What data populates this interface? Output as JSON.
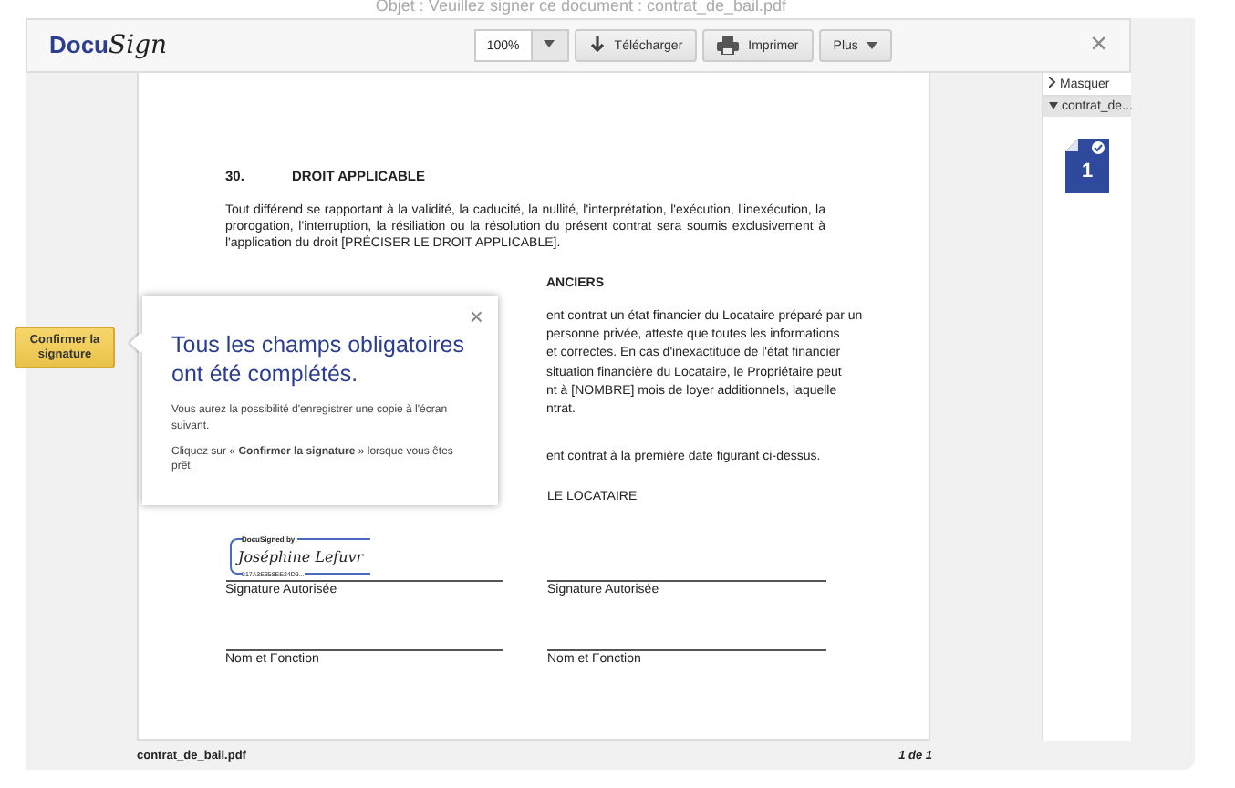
{
  "window": {
    "title": "Objet : Veuillez signer ce document : contrat_de_bail.pdf"
  },
  "toolbar": {
    "logo": {
      "main": "Docu",
      "script": "Sign"
    },
    "zoom": "100%",
    "buttons": [
      {
        "kind": "download",
        "label": "Télécharger"
      },
      {
        "kind": "print",
        "label": "Imprimer"
      },
      {
        "kind": "more",
        "label": "Plus"
      }
    ],
    "close": "×"
  },
  "confirm_button": "Confirmer la signature",
  "popup": {
    "title": "Tous les champs obligatoires ont été complétés.",
    "text_1": "Vous aurez la possibilité d'enregistrer une copie à l'écran suivant.",
    "text_2": "Cliquez sur « **Confirmer la signature** » lorsque vous êtes prêt.",
    "close": "×"
  },
  "document": {
    "section_number": "30.",
    "section_title": "DROIT APPLICABLE",
    "section_text": "Tout différend se rapportant à la validité, la caducité, la nullité, l'interprétation, l'exécution, l'inexécution, la prorogation, l'interruption, la résiliation ou la résolution du présent contrat sera soumis exclusivement à l'application du droit [PRÉCISER LE DROIT APPLICABLE].",
    "partial_heading": "ANCIERS",
    "partial_lines": [
      "ent contrat un état financier du Locataire préparé par un",
      "personne privée, atteste que toutes les informations",
      "et correctes. En cas d'inexactitude de l'état financier",
      "situation financière du Locataire, le Propriétaire peut",
      "nt à [NOMBRE] mois de loyer additionnels, laquelle",
      "ntrat."
    ],
    "partial_closing": "ent contrat à la première date figurant ci-dessus.",
    "signatures": [
      {
        "stamp_label": "DocuSigned by:",
        "signature": "Joséphine Lefuvr",
        "stamp_id": "317A3E358EE24D9...",
        "signature_label": "Signature Autorisée",
        "name_label": "Nom et Fonction"
      },
      {
        "party": "LE LOCATAIRE",
        "signature_label": "Signature Autorisée",
        "name_label": "Nom et Fonction"
      }
    ],
    "filename": "contrat_de_bail.pdf",
    "page_count": "1 de 1"
  },
  "side_panel": {
    "hide": "Masquer",
    "document": "contrat_de...",
    "page_number": "1"
  }
}
